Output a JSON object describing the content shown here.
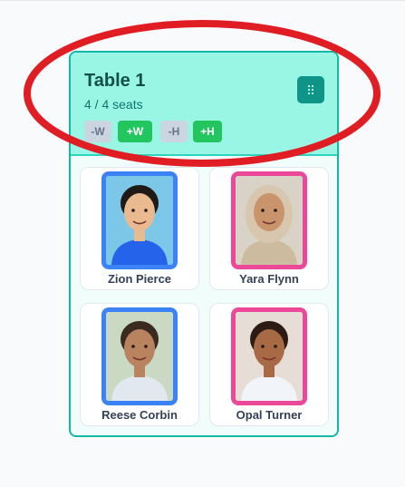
{
  "table": {
    "title": "Table 1",
    "seats": "4 / 4 seats",
    "controls": {
      "width_minus": "-W",
      "width_plus": "+W",
      "height_minus": "-H",
      "height_plus": "+H"
    },
    "drag_icon": "grip-dots-icon"
  },
  "students": [
    {
      "name": "Zion Pierce",
      "frame_color": "#3b82f6",
      "photo_bg": "#7cc6e8",
      "skin": "#e9b98f",
      "hair": "#1f1a17",
      "shirt": "#2563eb"
    },
    {
      "name": "Yara Flynn",
      "frame_color": "#ec4899",
      "photo_bg": "#d9d3c7",
      "skin": "#c9946b",
      "hair": "#d8c7ae",
      "shirt": "#cdbb9f"
    },
    {
      "name": "Reese Corbin",
      "frame_color": "#3b82f6",
      "photo_bg": "#c9d9c4",
      "skin": "#b98360",
      "hair": "#3a2a20",
      "shirt": "#e2e8f0"
    },
    {
      "name": "Opal Turner",
      "frame_color": "#ec4899",
      "photo_bg": "#e6ded6",
      "skin": "#a86a45",
      "hair": "#2b1b14",
      "shirt": "#f1f5f9"
    }
  ],
  "annotation": {
    "color": "#e11d24"
  }
}
